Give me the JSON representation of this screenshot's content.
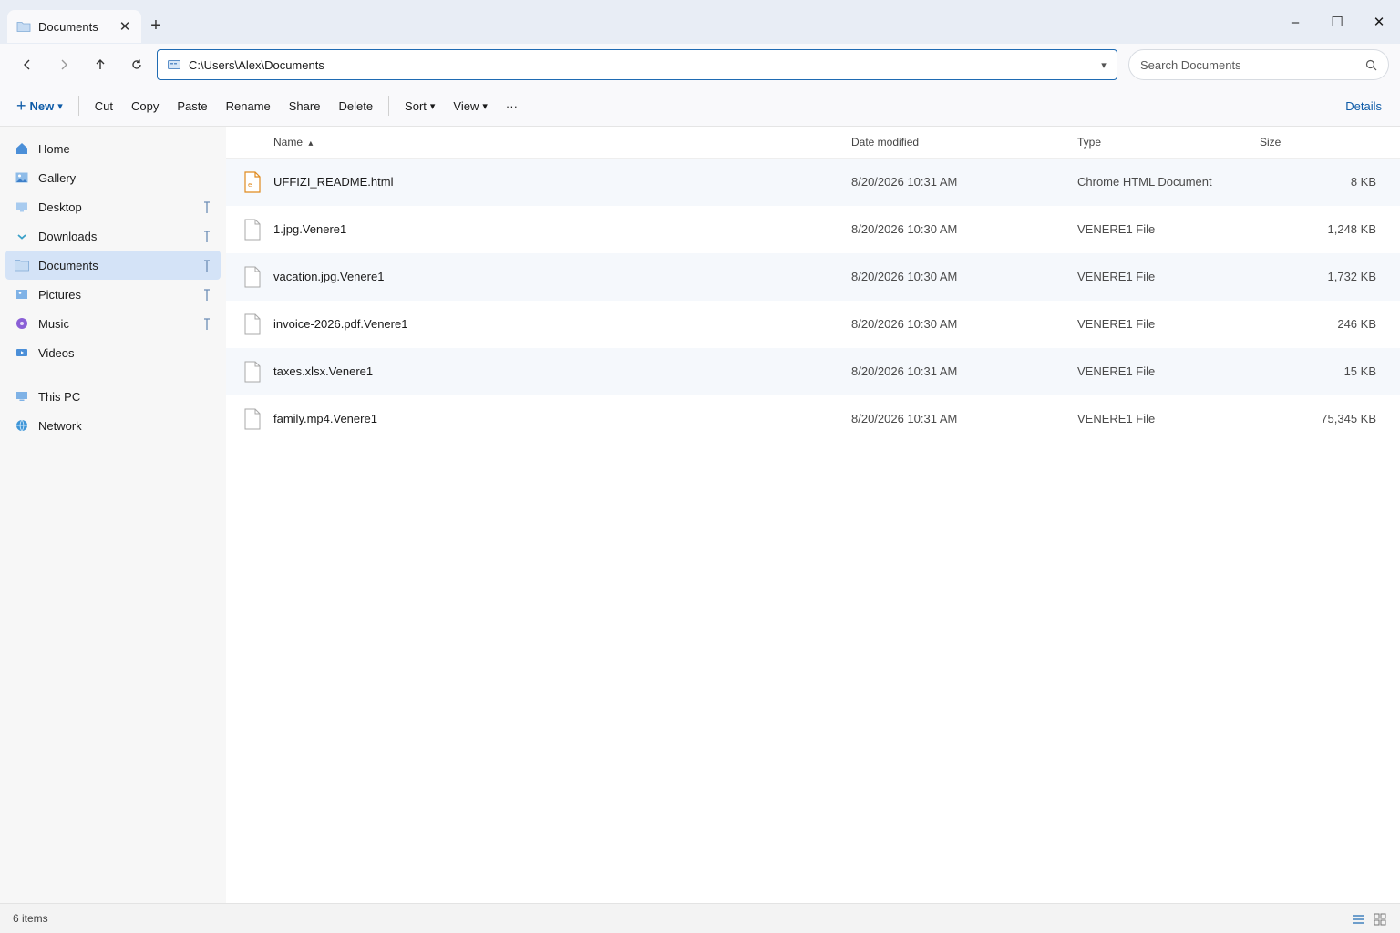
{
  "window": {
    "tab_title": "Documents",
    "tab_icon": "folder-icon",
    "controls": [
      "minimize",
      "maximize",
      "close"
    ]
  },
  "address": {
    "path": "C:\\Users\\Alex\\Documents",
    "search_placeholder": "Search Documents"
  },
  "commands": {
    "new": "New",
    "cut": "Cut",
    "copy": "Copy",
    "paste": "Paste",
    "rename": "Rename",
    "share": "Share",
    "delete": "Delete",
    "sort": "Sort",
    "view": "View",
    "more": "···",
    "details": "Details"
  },
  "sidebar": {
    "items": [
      {
        "label": "Home",
        "icon": "home-icon",
        "pinned": false
      },
      {
        "label": "Gallery",
        "icon": "gallery-icon",
        "pinned": false
      },
      {
        "label": "Desktop",
        "icon": "desktop-icon",
        "pinned": true
      },
      {
        "label": "Downloads",
        "icon": "download-icon",
        "pinned": true
      },
      {
        "label": "Documents",
        "icon": "folder-icon",
        "pinned": true,
        "active": true
      },
      {
        "label": "Pictures",
        "icon": "pictures-icon",
        "pinned": true
      },
      {
        "label": "Music",
        "icon": "music-icon",
        "pinned": true
      },
      {
        "label": "Videos",
        "icon": "videos-icon",
        "pinned": false
      }
    ],
    "locations": [
      {
        "label": "This PC",
        "icon": "computer-icon"
      },
      {
        "label": "Network",
        "icon": "network-icon"
      }
    ]
  },
  "columns": {
    "name": "Name",
    "sort_indicator": "▴",
    "date": "Date modified",
    "type": "Type",
    "size": "Size"
  },
  "files": [
    {
      "name": "UFFIZI_README.html",
      "date": "8/20/2026 10:31 AM",
      "type": "Chrome HTML Document",
      "size": "8 KB",
      "icon": "html-file-icon"
    },
    {
      "name": "1.jpg.Venere1",
      "date": "8/20/2026 10:30 AM",
      "type": "VENERE1 File",
      "size": "1,248 KB",
      "icon": "file-icon"
    },
    {
      "name": "vacation.jpg.Venere1",
      "date": "8/20/2026 10:30 AM",
      "type": "VENERE1 File",
      "size": "1,732 KB",
      "icon": "file-icon"
    },
    {
      "name": "invoice-2026.pdf.Venere1",
      "date": "8/20/2026 10:30 AM",
      "type": "VENERE1 File",
      "size": "246 KB",
      "icon": "file-icon"
    },
    {
      "name": "taxes.xlsx.Venere1",
      "date": "8/20/2026 10:31 AM",
      "type": "VENERE1 File",
      "size": "15 KB",
      "icon": "file-icon"
    },
    {
      "name": "family.mp4.Venere1",
      "date": "8/20/2026 10:31 AM",
      "type": "VENERE1 File",
      "size": "75,345 KB",
      "icon": "file-icon"
    }
  ],
  "status": {
    "item_count": "6 items"
  },
  "colors": {
    "accent": "#0f5ca8",
    "active_nav": "#d4e3f7",
    "alt_row": "#f5f8fc"
  }
}
